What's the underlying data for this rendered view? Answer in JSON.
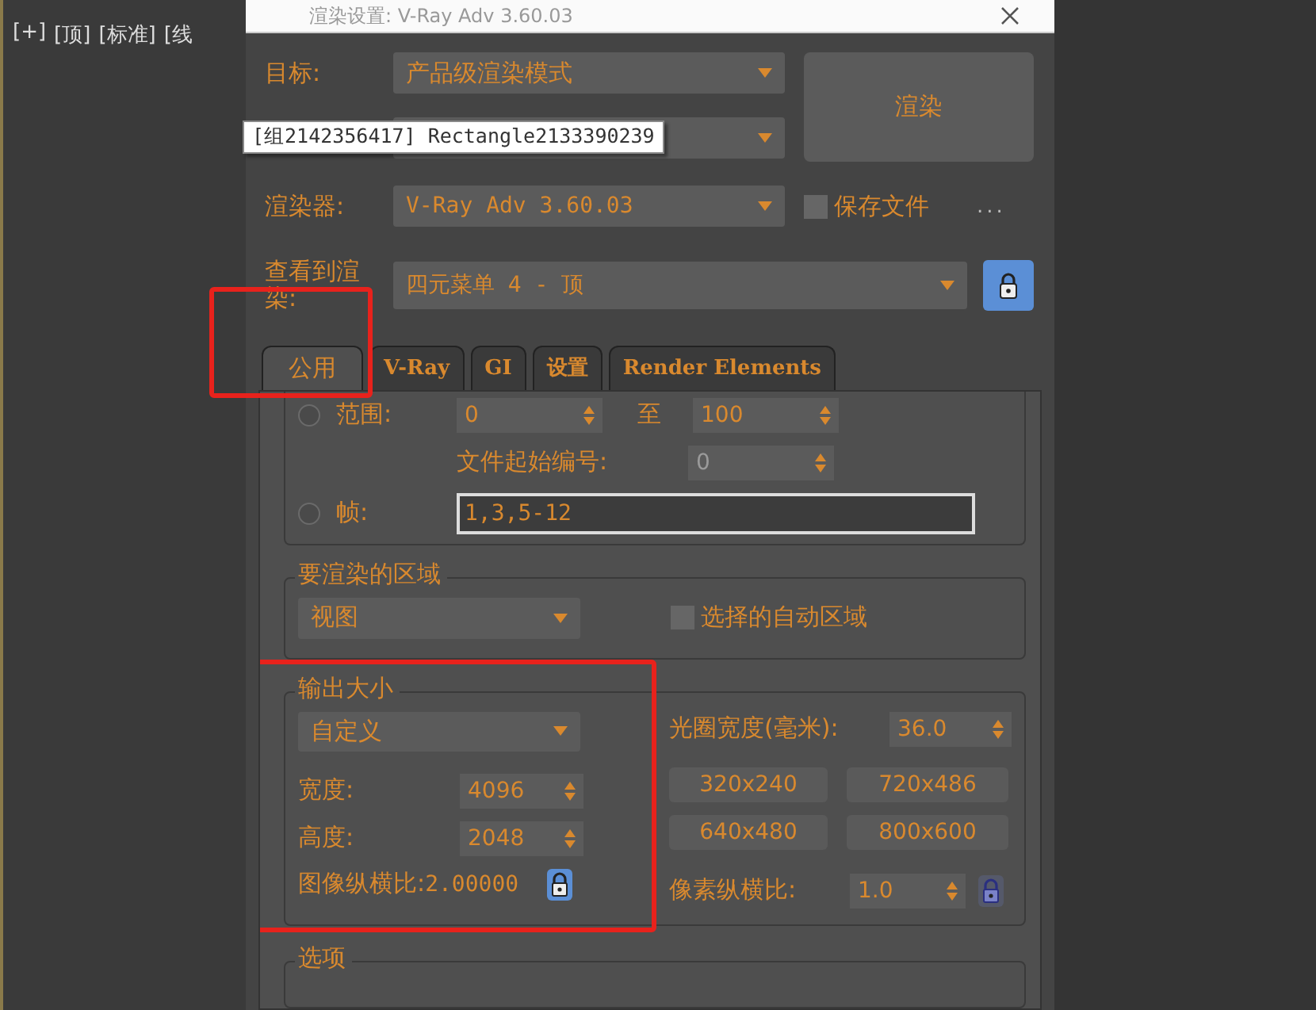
{
  "viewport": {
    "labels": [
      "[+]",
      "[顶]",
      "[标准]",
      "[线"
    ]
  },
  "window": {
    "title": "渲染设置: V-Ray Adv 3.60.03"
  },
  "target": {
    "label": "目标:",
    "value": "产品级渲染模式"
  },
  "render_button": "渲染",
  "tooltip": "[组2142356417] Rectangle2133390239",
  "renderer": {
    "label": "渲染器:",
    "value": "V-Ray Adv 3.60.03"
  },
  "save_file": {
    "label": "保存文件",
    "checked": false
  },
  "more_button": "...",
  "view": {
    "label": "查看到渲染:",
    "value": "四元菜单 4 - 顶",
    "locked": true
  },
  "tabs": [
    {
      "label": "公用",
      "selected": true,
      "highlighted": true
    },
    {
      "label": "V-Ray",
      "selected": false,
      "highlighted": false
    },
    {
      "label": "GI",
      "selected": false,
      "highlighted": false
    },
    {
      "label": "设置",
      "selected": false,
      "highlighted": false
    },
    {
      "label": "Render Elements",
      "selected": false,
      "highlighted": false
    }
  ],
  "time_output": {
    "range": {
      "label": "范围:",
      "from": "0",
      "to_label": "至",
      "to": "100",
      "selected": false
    },
    "file_start": {
      "label": "文件起始编号:",
      "value": "0"
    },
    "frames": {
      "label": "帧:",
      "value": "1,3,5-12",
      "selected": false
    }
  },
  "area": {
    "title": "要渲染的区域",
    "value": "视图",
    "auto_region": {
      "label": "选择的自动区域",
      "checked": false
    }
  },
  "output_size": {
    "title": "输出大小",
    "highlighted": true,
    "preset": "自定义",
    "aperture": {
      "label": "光圈宽度(毫米):",
      "value": "36.0"
    },
    "width": {
      "label": "宽度:",
      "value": "4096"
    },
    "height": {
      "label": "高度:",
      "value": "2048"
    },
    "presets": [
      "320x240",
      "720x486",
      "640x480",
      "800x600"
    ],
    "image_aspect": {
      "label": "图像纵横比:",
      "value": "2.00000",
      "locked": true
    },
    "pixel_aspect": {
      "label": "像素纵横比:",
      "value": "1.0",
      "locked": false
    }
  },
  "options": {
    "title": "选项"
  }
}
